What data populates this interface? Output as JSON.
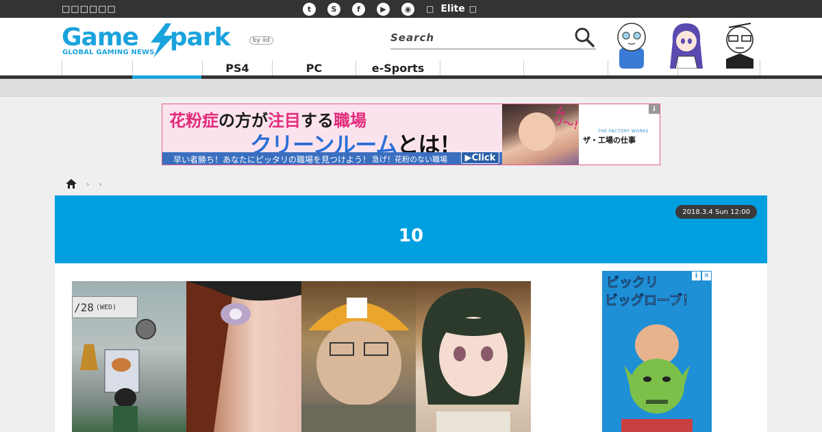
{
  "topbar": {
    "site_label": "□□□□□□",
    "social": [
      {
        "name": "twitter-icon",
        "glyph": "t"
      },
      {
        "name": "steam-icon",
        "glyph": "S"
      },
      {
        "name": "facebook-icon",
        "glyph": "f"
      },
      {
        "name": "youtube-icon",
        "glyph": "▶"
      },
      {
        "name": "rss-icon",
        "glyph": "◉"
      }
    ],
    "left_glyph": "□",
    "elite_label": "Elite",
    "right_glyph": "□"
  },
  "header": {
    "logo_wordmark_left": "Game",
    "logo_wordmark_right": "park",
    "logo_tagline": "GLOBAL GAMING NEWS",
    "logo_by": "by iid",
    "search_placeholder": "Search"
  },
  "nav": {
    "items": [
      "",
      "",
      "PS4",
      "PC",
      "e-Sports",
      "",
      "",
      "",
      "",
      ""
    ],
    "active_index": 1
  },
  "ad_banner": {
    "line1_a": "花粉症",
    "line1_b": "の方が",
    "line1_c": "注目",
    "line1_d": "する",
    "line1_e": "職場",
    "line2_blue": "クリーンルーム",
    "line2_dark": "とは！",
    "strip_text": "早い者勝ち！あなたにピッタリの職場を見つけよう！",
    "strip_text2": "急げ！花粉のない職場",
    "click_label": "▶Click",
    "muri": "ムリ〜！",
    "factory_top": "THE FACTORY WORKS",
    "factory_sub": "ザ・工場の仕事",
    "info": "i"
  },
  "breadcrumb": {
    "sep1": "›",
    "sep2": "›"
  },
  "article": {
    "date": "2018.3.4 Sun 12:00",
    "title": "10"
  },
  "main_image": {
    "phone_time": "/28",
    "phone_day": "(WED)"
  },
  "side_ad": {
    "line1": "ビックリ",
    "line2": "ビッグローブ！",
    "badge_info": "i",
    "badge_close": "✕"
  },
  "colors": {
    "accent": "#009fe0",
    "topbar": "#333333",
    "logo": "#1aa3dd"
  }
}
